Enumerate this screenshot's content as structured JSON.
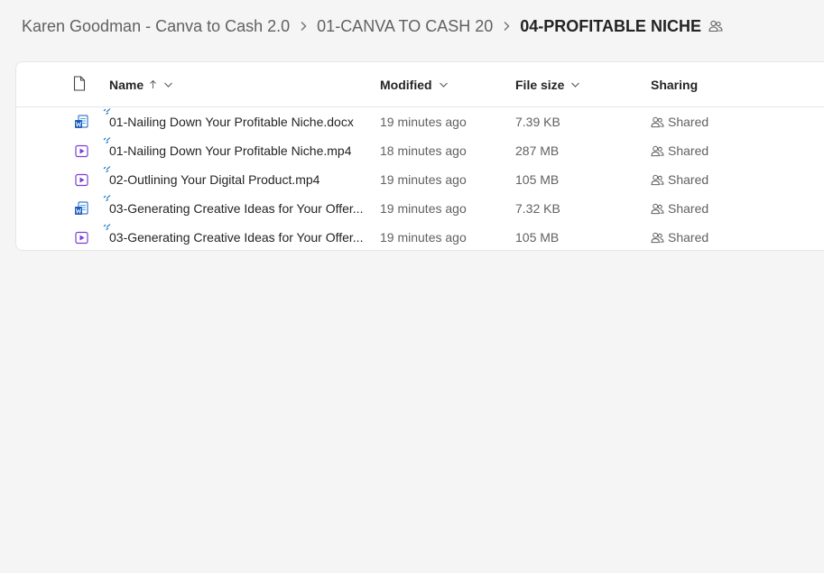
{
  "breadcrumb": {
    "items": [
      "Karen Goodman - Canva to Cash 2.0",
      "01-CANVA TO CASH 20"
    ],
    "current": "04-PROFITABLE NICHE"
  },
  "columns": {
    "name": "Name",
    "modified": "Modified",
    "file_size": "File size",
    "sharing": "Sharing"
  },
  "files": [
    {
      "name": "01-Nailing Down Your Profitable Niche.docx",
      "type": "word",
      "modified": "19 minutes ago",
      "size": "7.39 KB",
      "sharing": "Shared"
    },
    {
      "name": "01-Nailing Down Your Profitable Niche.mp4",
      "type": "video",
      "modified": "18 minutes ago",
      "size": "287 MB",
      "sharing": "Shared"
    },
    {
      "name": "02-Outlining Your Digital Product.mp4",
      "type": "video",
      "modified": "19 minutes ago",
      "size": "105 MB",
      "sharing": "Shared"
    },
    {
      "name": "03-Generating Creative Ideas for Your Offer...",
      "type": "word",
      "modified": "19 minutes ago",
      "size": "7.32 KB",
      "sharing": "Shared"
    },
    {
      "name": "03-Generating Creative Ideas for Your Offer...",
      "type": "video",
      "modified": "19 minutes ago",
      "size": "105 MB",
      "sharing": "Shared"
    }
  ],
  "colors": {
    "accent": "#0f6cbd",
    "word_blue": "#185abd",
    "video_purple": "#7a3fd1"
  },
  "icons": {
    "type_header": "file-icon",
    "word": "word-doc-icon",
    "video": "video-file-icon",
    "shared": "people-icon",
    "new": "new-item-sparkle-icon"
  }
}
